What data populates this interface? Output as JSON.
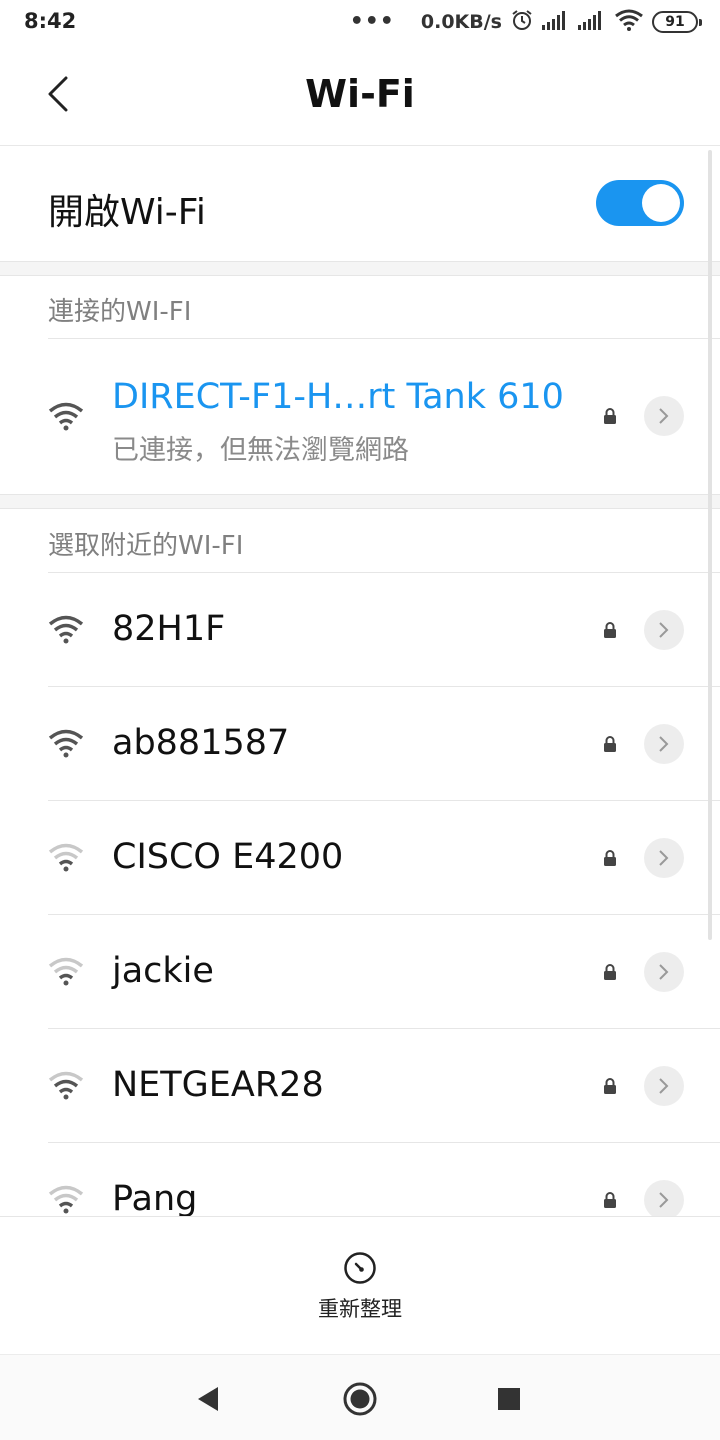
{
  "status_bar": {
    "time": "8:42",
    "dots": "•••",
    "net_speed": "0.0KB/s",
    "battery": "91"
  },
  "header": {
    "title": "Wi-Fi"
  },
  "wifi_toggle": {
    "label": "開啟Wi-Fi",
    "enabled": true,
    "accent_color": "#1a95f0"
  },
  "connected_section": {
    "header": "連接的WI-FI",
    "network": {
      "name": "DIRECT-F1-H…rt Tank 610",
      "status": "已連接，但無法瀏覽網路",
      "secured": true,
      "name_color": "#1a95f0"
    }
  },
  "nearby_section": {
    "header": "選取附近的WI-FI",
    "networks": [
      {
        "name": "82H1F",
        "secured": true,
        "signal": "strong"
      },
      {
        "name": "ab881587",
        "secured": true,
        "signal": "strong"
      },
      {
        "name": "CISCO E4200",
        "secured": true,
        "signal": "weak"
      },
      {
        "name": "jackie",
        "secured": true,
        "signal": "weak"
      },
      {
        "name": "NETGEAR28",
        "secured": true,
        "signal": "medium"
      },
      {
        "name": "Pang",
        "secured": true,
        "signal": "weak"
      }
    ]
  },
  "bottom_action": {
    "refresh_label": "重新整理"
  }
}
